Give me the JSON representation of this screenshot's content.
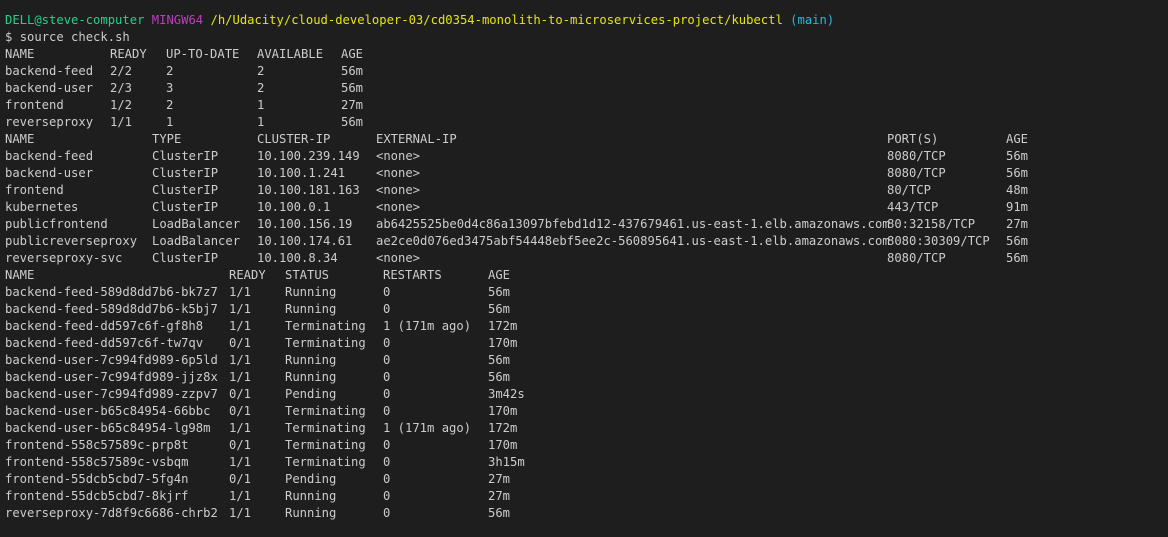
{
  "prompt": {
    "user_host": "DELL@steve-computer",
    "shell": "MINGW64",
    "path": "/h/Udacity/cloud-developer-03/cd0354-monolith-to-microservices-project/kubectl",
    "branch": "(main)",
    "symbol": "$",
    "command": "source check.sh"
  },
  "deployments": {
    "headers": [
      "NAME",
      "READY",
      "UP-TO-DATE",
      "AVAILABLE",
      "AGE"
    ],
    "rows": [
      [
        "backend-feed",
        "2/2",
        "2",
        "2",
        "56m"
      ],
      [
        "backend-user",
        "2/3",
        "3",
        "2",
        "56m"
      ],
      [
        "frontend",
        "1/2",
        "2",
        "1",
        "27m"
      ],
      [
        "reverseproxy",
        "1/1",
        "1",
        "1",
        "56m"
      ]
    ]
  },
  "services": {
    "headers": [
      "NAME",
      "TYPE",
      "CLUSTER-IP",
      "EXTERNAL-IP",
      "PORT(S)",
      "AGE"
    ],
    "rows": [
      [
        "backend-feed",
        "ClusterIP",
        "10.100.239.149",
        "<none>",
        "8080/TCP",
        "56m"
      ],
      [
        "backend-user",
        "ClusterIP",
        "10.100.1.241",
        "<none>",
        "8080/TCP",
        "56m"
      ],
      [
        "frontend",
        "ClusterIP",
        "10.100.181.163",
        "<none>",
        "80/TCP",
        "48m"
      ],
      [
        "kubernetes",
        "ClusterIP",
        "10.100.0.1",
        "<none>",
        "443/TCP",
        "91m"
      ],
      [
        "publicfrontend",
        "LoadBalancer",
        "10.100.156.19",
        "ab6425525be0d4c86a13097bfebd1d12-437679461.us-east-1.elb.amazonaws.com",
        "80:32158/TCP",
        "27m"
      ],
      [
        "publicreverseproxy",
        "LoadBalancer",
        "10.100.174.61",
        "ae2ce0d076ed3475abf54448ebf5ee2c-560895641.us-east-1.elb.amazonaws.com",
        "8080:30309/TCP",
        "56m"
      ],
      [
        "reverseproxy-svc",
        "ClusterIP",
        "10.100.8.34",
        "<none>",
        "8080/TCP",
        "56m"
      ]
    ]
  },
  "pods": {
    "headers": [
      "NAME",
      "READY",
      "STATUS",
      "RESTARTS",
      "AGE"
    ],
    "rows": [
      [
        "backend-feed-589d8dd7b6-bk7z7",
        "1/1",
        "Running",
        "0",
        "56m"
      ],
      [
        "backend-feed-589d8dd7b6-k5bj7",
        "1/1",
        "Running",
        "0",
        "56m"
      ],
      [
        "backend-feed-dd597c6f-gf8h8",
        "1/1",
        "Terminating",
        "1 (171m ago)",
        "172m"
      ],
      [
        "backend-feed-dd597c6f-tw7qv",
        "0/1",
        "Terminating",
        "0",
        "170m"
      ],
      [
        "backend-user-7c994fd989-6p5ld",
        "1/1",
        "Running",
        "0",
        "56m"
      ],
      [
        "backend-user-7c994fd989-jjz8x",
        "1/1",
        "Running",
        "0",
        "56m"
      ],
      [
        "backend-user-7c994fd989-zzpv7",
        "0/1",
        "Pending",
        "0",
        "3m42s"
      ],
      [
        "backend-user-b65c84954-66bbc",
        "0/1",
        "Terminating",
        "0",
        "170m"
      ],
      [
        "backend-user-b65c84954-lg98m",
        "1/1",
        "Terminating",
        "1 (171m ago)",
        "172m"
      ],
      [
        "frontend-558c57589c-prp8t",
        "0/1",
        "Terminating",
        "0",
        "170m"
      ],
      [
        "frontend-558c57589c-vsbqm",
        "1/1",
        "Terminating",
        "0",
        "3h15m"
      ],
      [
        "frontend-55dcb5cbd7-5fg4n",
        "0/1",
        "Pending",
        "0",
        "27m"
      ],
      [
        "frontend-55dcb5cbd7-8kjrf",
        "1/1",
        "Running",
        "0",
        "27m"
      ],
      [
        "reverseproxy-7d8f9c6686-chrb2",
        "1/1",
        "Running",
        "0",
        "56m"
      ]
    ]
  },
  "colors": {
    "background": "#1e1e1e",
    "text": "#cccccc",
    "user_host": "#23d18b",
    "shell": "#bc3fbc",
    "path": "#e5e510",
    "branch": "#29b8db"
  }
}
